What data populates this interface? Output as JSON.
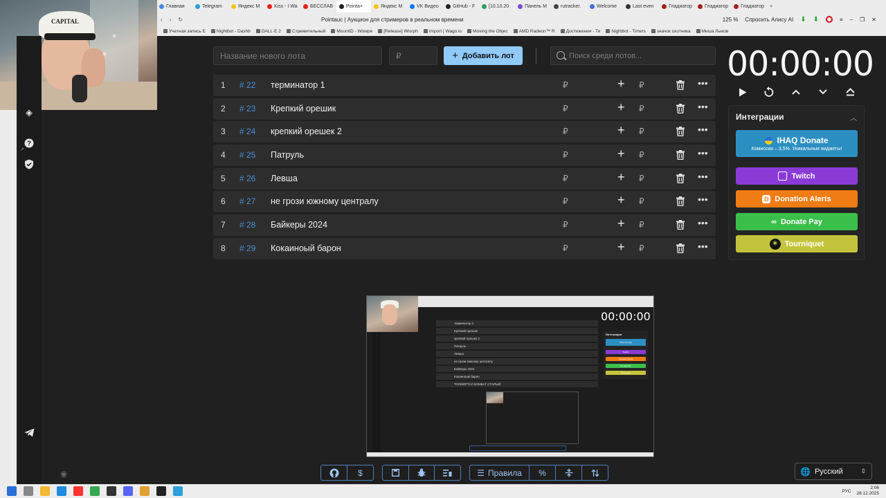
{
  "browser": {
    "tabs": [
      {
        "label": "Главная",
        "color": "#4f86e5"
      },
      {
        "label": "Telegram",
        "color": "#2aa1da"
      },
      {
        "label": "Яндекс М",
        "color": "#f5c518"
      },
      {
        "label": "Kiss - I Wa",
        "color": "#e62117"
      },
      {
        "label": "БЕССЛАВ",
        "color": "#e62117"
      },
      {
        "label": "Pointa×",
        "color": "#222222",
        "active": true
      },
      {
        "label": "Яндекс М",
        "color": "#f5c518"
      },
      {
        "label": "VK Видео",
        "color": "#0077ff"
      },
      {
        "label": "GitHub - F",
        "color": "#222222"
      },
      {
        "label": "[10.10.20",
        "color": "#2d9d59"
      },
      {
        "label": "Панель М",
        "color": "#7b4bd0"
      },
      {
        "label": "rutracker.",
        "color": "#444444"
      },
      {
        "label": "Welcome",
        "color": "#3d6fd9"
      },
      {
        "label": "Last even",
        "color": "#333333"
      },
      {
        "label": "Гладиатор",
        "color": "#a2231d"
      },
      {
        "label": "Гладиатор",
        "color": "#a2231d"
      },
      {
        "label": "Гладиатор",
        "color": "#a2231d"
      }
    ],
    "page_title": "Pointauc | Аукцион для стримеров в реальном времени",
    "zoom": "125 %",
    "alice_label": "Спросить Алису AI",
    "bookmarks": [
      "Учетная запись Е",
      "Nightbot - Dashb",
      "DALL·E 2",
      "Стремительный",
      "MountID - Wowpe",
      "[Release] IMorph",
      "Import | Wago.io",
      "Moving the Objec",
      "AMD Radeon™ R",
      "Достижения - Ти",
      "Nightbot - Timers",
      "значок охотника",
      "Миша Лыков"
    ]
  },
  "webcam": {
    "cap_text": "CAPITAL"
  },
  "form": {
    "lot_name_placeholder": "Название нового лота",
    "price_placeholder": "₽",
    "add_button_label": "Добавить лот",
    "search_placeholder": "Поиск среди лотов..."
  },
  "lots": [
    {
      "num": "1",
      "id": "# 22",
      "name": " терминатор 1",
      "amount": "₽",
      "rub": "₽"
    },
    {
      "num": "2",
      "id": "# 23",
      "name": "Крепкий орешик",
      "amount": "₽",
      "rub": "₽"
    },
    {
      "num": "3",
      "id": "# 24",
      "name": " крепкий орешек 2",
      "amount": "₽",
      "rub": "₽"
    },
    {
      "num": "4",
      "id": "# 25",
      "name": "Патруль",
      "amount": "₽",
      "rub": "₽"
    },
    {
      "num": "5",
      "id": "# 26",
      "name": "Левша",
      "amount": "₽",
      "rub": "₽"
    },
    {
      "num": "6",
      "id": "# 27",
      "name": "не грози южному централу",
      "amount": "₽",
      "rub": "₽"
    },
    {
      "num": "7",
      "id": "# 28",
      "name": "Байкеры 2024",
      "amount": "₽",
      "rub": "₽"
    },
    {
      "num": "8",
      "id": "# 29",
      "name": "Кокаиноый барон",
      "amount": "₽",
      "rub": "₽"
    }
  ],
  "timer": {
    "value": "00:00:00"
  },
  "integrations": {
    "title": "Интеграции",
    "ihaq_label": "IHAQ Donate",
    "ihaq_sub": "Комиссия – 3,5%. Уникальные виджеты!",
    "twitch_label": "Twitch",
    "donation_alerts_label": "Donation Alerts",
    "donate_pay_label": "Donate Pay",
    "tourniquet_label": "Tourniquet"
  },
  "preview": {
    "rows": [
      "терминатор 1",
      "Крепкий орешик",
      "крепкий орешек 2",
      "Патруль",
      "Левша",
      "не грози южному централу",
      "Байкеры 2024",
      "Кокаиноый барон",
      "ТОЛМОРТАЛ КОМБАТ СТАРЫЙ"
    ],
    "timer": "00:00:00",
    "integrations_title": "Интеграции",
    "buttons": [
      {
        "label": "IHAQ Donate",
        "color": "#2c8fc1"
      },
      {
        "label": "Twitch",
        "color": "#8a3bd6"
      },
      {
        "label": "Donation Alerts",
        "color": "#f07c14"
      },
      {
        "label": "Donate Pay",
        "color": "#3bbf4b"
      },
      {
        "label": "Tourniquet",
        "color": "#c4c43c"
      }
    ]
  },
  "bottom": {
    "rules_label": "Правила",
    "language": "Русский"
  },
  "taskbar": {
    "lang": "РУС",
    "time": "2:06",
    "date": "28.12.2025"
  },
  "colors": {
    "accent": "#90caf9",
    "link_blue": "#4a8fd4",
    "bg": "#202020",
    "row_bg": "#2d2d2d"
  }
}
